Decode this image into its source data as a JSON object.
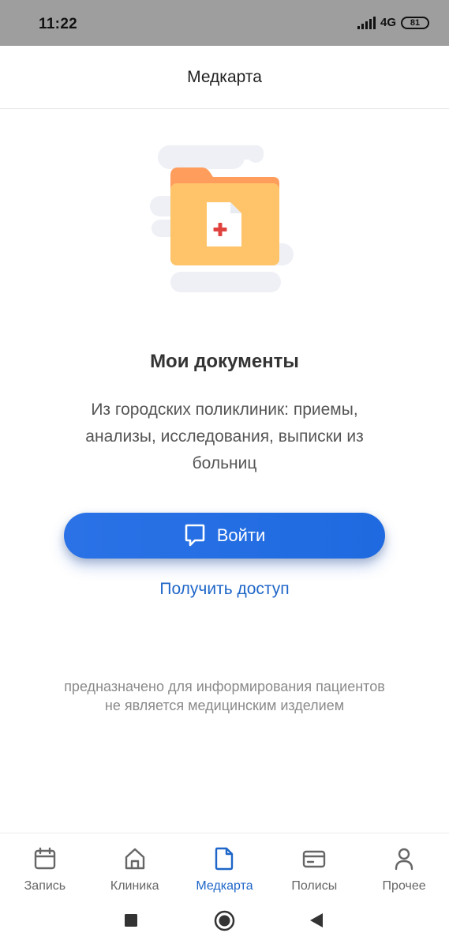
{
  "status_bar": {
    "time": "11:22",
    "network": "4G",
    "battery": "81"
  },
  "header": {
    "title": "Медкарта"
  },
  "main": {
    "title": "Мои документы",
    "description": "Из городских поликлиник: приемы, анализы, исследования, выписки из больниц",
    "login_label": "Войти",
    "access_link": "Получить доступ",
    "disclaimer_line1": "предназначено для информирования пациентов",
    "disclaimer_line2": "не является медицинским изделием"
  },
  "bottom_nav": {
    "items": [
      {
        "label": "Запись",
        "icon": "calendar-icon"
      },
      {
        "label": "Клиника",
        "icon": "home-icon"
      },
      {
        "label": "Медкарта",
        "icon": "document-icon",
        "active": true
      },
      {
        "label": "Полисы",
        "icon": "card-icon"
      },
      {
        "label": "Прочее",
        "icon": "person-icon"
      }
    ]
  },
  "colors": {
    "accent": "#1e66c8",
    "button": "#2a72e6",
    "folder_front": "#ffc46a",
    "folder_back": "#ff9d5c",
    "plus": "#e0433f"
  }
}
